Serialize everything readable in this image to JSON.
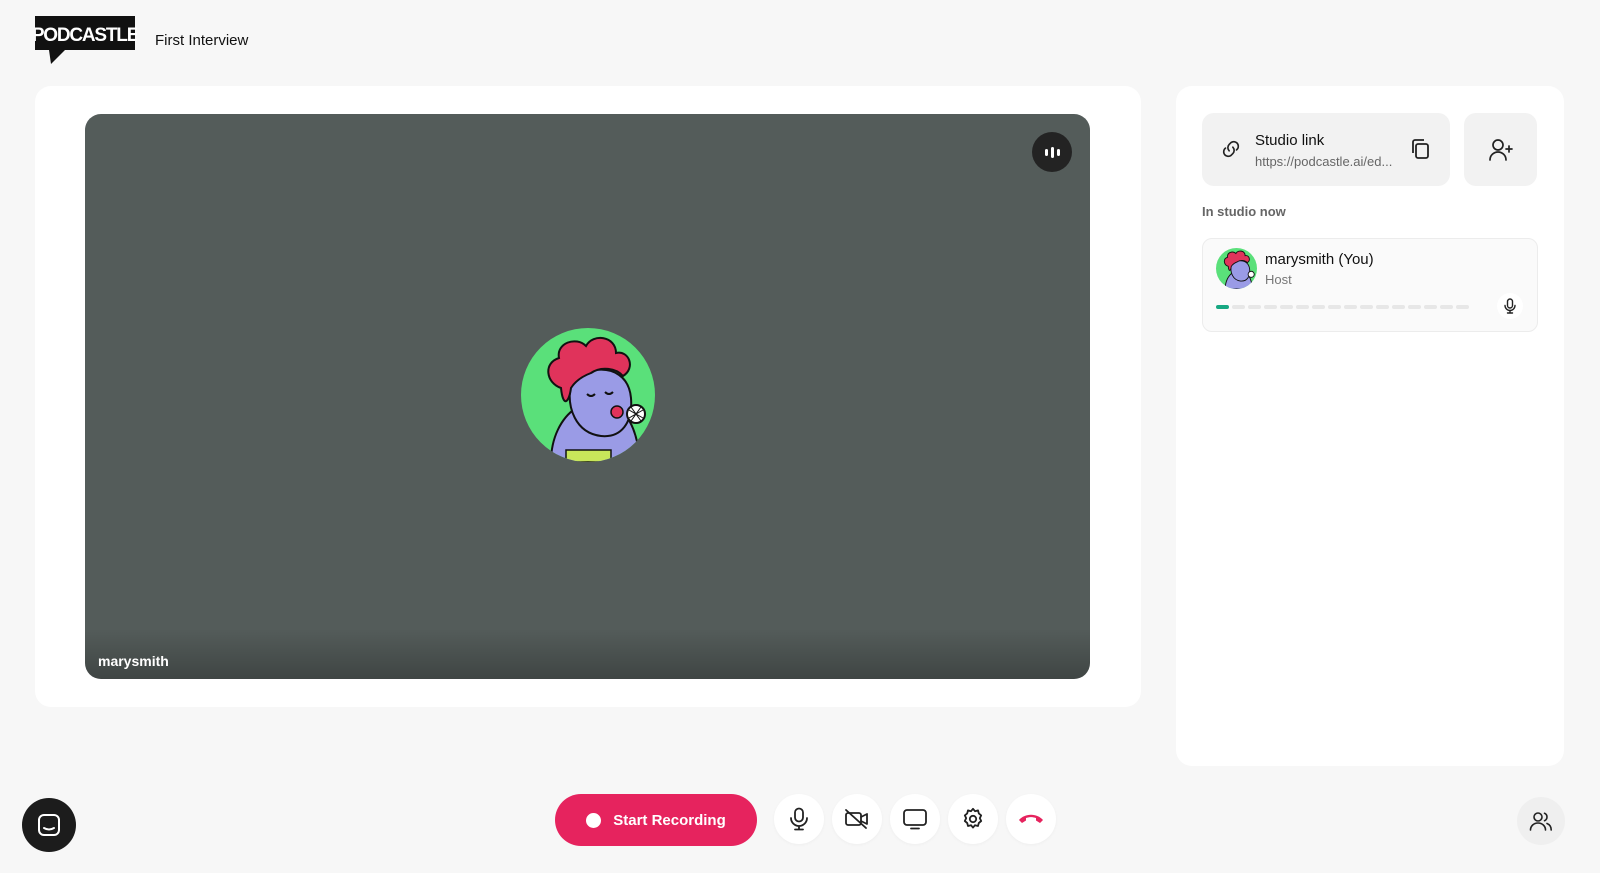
{
  "header": {
    "logo_text": "PODCASTLE",
    "project_title": "First Interview"
  },
  "stage": {
    "participant_name": "marysmith"
  },
  "side_panel": {
    "studio_link_title": "Studio link",
    "studio_link_url": "https://podcastle.ai/ed...",
    "in_studio_heading": "In studio now",
    "participants": [
      {
        "name": "marysmith (You)",
        "role": "Host",
        "audio_level": 0.06
      }
    ]
  },
  "controls": {
    "record_label": "Start Recording"
  },
  "colors": {
    "accent": "#e6235e",
    "video_bg": "#545c5a",
    "level_active": "#17a882",
    "avatar_bg": "#5ae07a",
    "avatar_hair": "#e0335b",
    "avatar_skin": "#9a9be6"
  }
}
